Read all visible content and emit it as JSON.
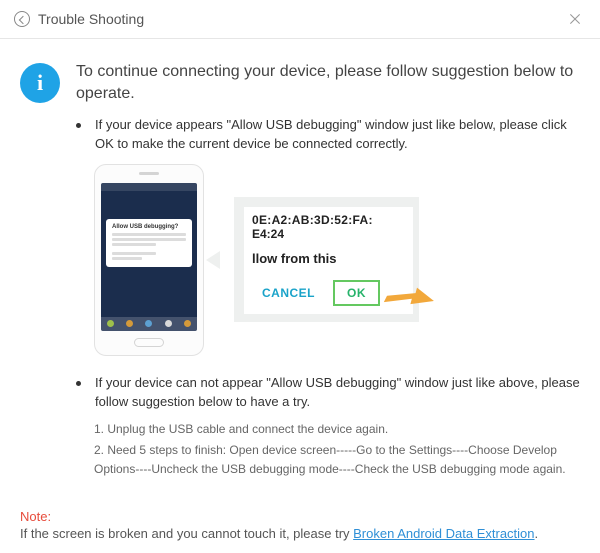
{
  "titlebar": {
    "title": "Trouble Shooting"
  },
  "main_instruction": "To continue connecting your device, please follow suggestion below to operate.",
  "bullets": [
    "If your device appears \"Allow USB debugging\" window just like below, please click OK to make the current device  be connected correctly.",
    "If your device can not appear \"Allow USB debugging\" window just like above, please follow suggestion below to have a try."
  ],
  "phone_dialog": {
    "title": "Allow USB debugging?"
  },
  "zoom": {
    "mac1": "0E:A2:AB:3D:52:FA:",
    "mac2": "E4:24",
    "allow": "llow from this",
    "cancel": "CANCEL",
    "ok": "OK"
  },
  "steps": [
    "1. Unplug the USB cable and connect the device again.",
    "2. Need 5 steps to finish: Open device screen-----Go to the Settings----Choose Develop Options----Uncheck the USB debugging mode----Check the USB debugging mode again."
  ],
  "note": {
    "label": "Note:",
    "text": "If the screen is broken and you cannot touch it, please try ",
    "link": "Broken Android Data Extraction",
    "after": "."
  }
}
